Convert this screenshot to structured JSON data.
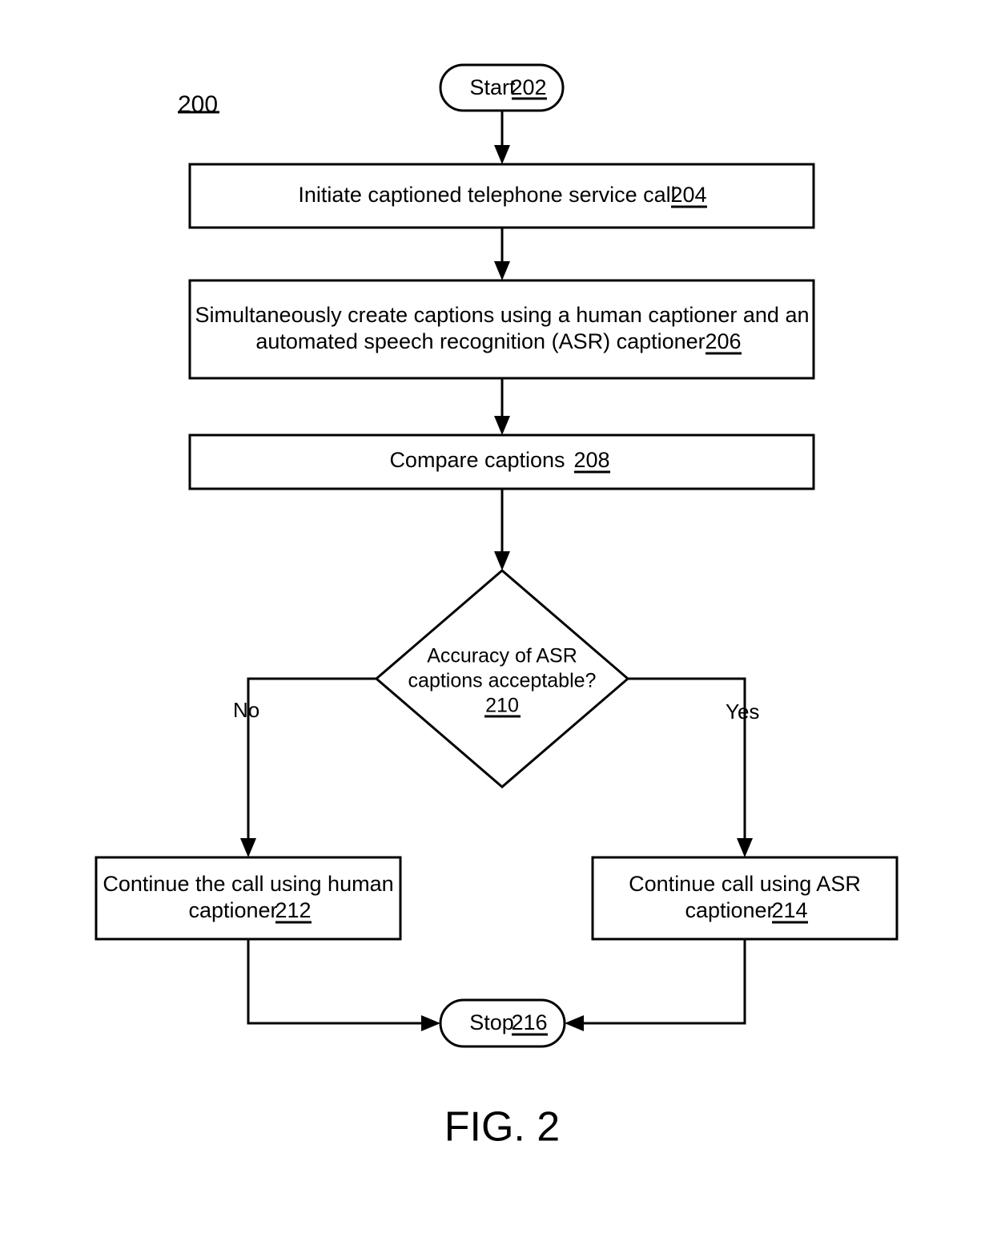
{
  "figure": {
    "number_label": "200",
    "caption": "FIG. 2"
  },
  "nodes": {
    "start": {
      "id": "202",
      "shape": "rounded-pill",
      "text": "Start",
      "ref": "202"
    },
    "initiate_call": {
      "id": "204",
      "shape": "rectangle",
      "lines": [
        "Initiate captioned telephone service call"
      ],
      "ref": "204"
    },
    "create_captions": {
      "id": "206",
      "shape": "rectangle",
      "lines": [
        "Simultaneously create captions using a human captioner and an",
        "automated speech recognition (ASR) captioner"
      ],
      "ref": "206"
    },
    "compare_captions": {
      "id": "208",
      "shape": "rectangle",
      "lines": [
        "Compare captions"
      ],
      "ref": "208"
    },
    "decision_accuracy": {
      "id": "210",
      "shape": "diamond",
      "lines": [
        "Accuracy of ASR",
        "captions acceptable?"
      ],
      "ref": "210"
    },
    "continue_human": {
      "id": "212",
      "shape": "rectangle",
      "lines": [
        "Continue the call using human",
        "captioner"
      ],
      "ref": "212"
    },
    "continue_asr": {
      "id": "214",
      "shape": "rectangle",
      "lines": [
        "Continue call using ASR",
        "captioner"
      ],
      "ref": "214"
    },
    "stop": {
      "id": "216",
      "shape": "rounded-pill",
      "text": "Stop",
      "ref": "216"
    }
  },
  "branches": {
    "no_label": "No",
    "yes_label": "Yes"
  },
  "colors": {
    "stroke": "#000000",
    "fill": "#ffffff",
    "background": "#ffffff"
  }
}
